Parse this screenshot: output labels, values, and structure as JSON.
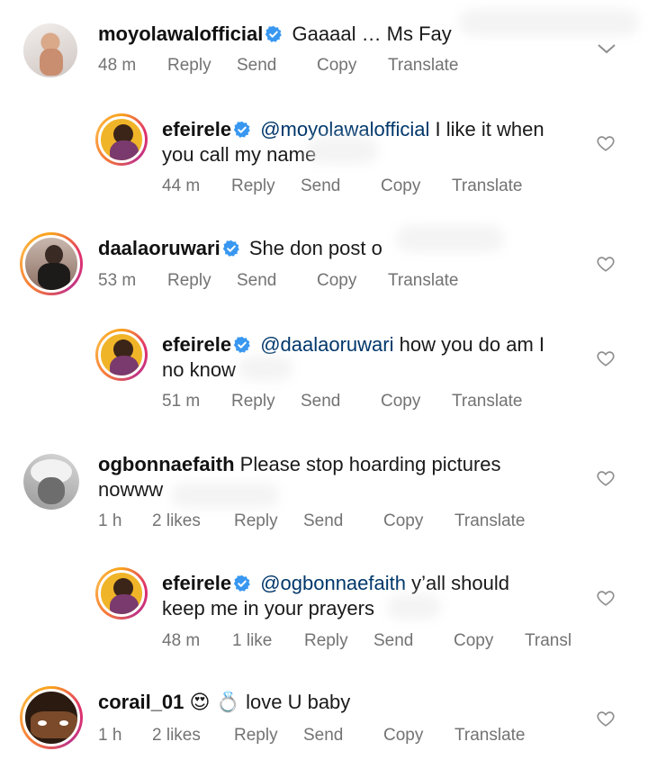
{
  "comments": [
    {
      "username": "moyolawalofficial",
      "verified": true,
      "mention": "",
      "text": "Gaaaal … Ms Fay",
      "time": "48 m",
      "likes": "",
      "actions": {
        "reply": "Reply",
        "send": "Send",
        "copy": "Copy",
        "translate": "Translate"
      }
    },
    {
      "username": "efeirele",
      "verified": true,
      "mention": "@moyolawalofficial",
      "text_line1": "I like it when",
      "text_line2": "you call my name",
      "time": "44 m",
      "actions": {
        "reply": "Reply",
        "send": "Send",
        "copy": "Copy",
        "translate": "Translate"
      }
    },
    {
      "username": "daalaoruwari",
      "verified": true,
      "text": "She don post o",
      "time": "53 m",
      "actions": {
        "reply": "Reply",
        "send": "Send",
        "copy": "Copy",
        "translate": "Translate"
      }
    },
    {
      "username": "efeirele",
      "verified": true,
      "mention": "@daalaoruwari",
      "text_line1": "how you do am I",
      "text_line2": "no know",
      "time": "51 m",
      "actions": {
        "reply": "Reply",
        "send": "Send",
        "copy": "Copy",
        "translate": "Translate"
      }
    },
    {
      "username": "ogbonnaefaith",
      "verified": false,
      "text_line1": "Please stop hoarding pictures",
      "text_line2": "nowww",
      "time": "1 h",
      "likes": "2 likes",
      "actions": {
        "reply": "Reply",
        "send": "Send",
        "copy": "Copy",
        "translate": "Translate"
      }
    },
    {
      "username": "efeirele",
      "verified": true,
      "mention": "@ogbonnaefaith",
      "text_line1": "y’all should",
      "text_line2": "keep me in your prayers",
      "time": "48 m",
      "likes": "1 like",
      "actions": {
        "reply": "Reply",
        "send": "Send",
        "copy": "Copy",
        "translate": "Transl"
      }
    },
    {
      "username": "corail_01",
      "verified": false,
      "emoji": "😍 💍",
      "text": "love U baby",
      "time": "1 h",
      "likes": "2 likes",
      "actions": {
        "reply": "Reply",
        "send": "Send",
        "copy": "Copy",
        "translate": "Translate"
      }
    }
  ],
  "colors": {
    "verified": "#3897f0",
    "mention": "#00376b",
    "meta": "#737373",
    "story_ring": [
      "#f9a11b",
      "#e1306c",
      "#c13584"
    ]
  },
  "icons": [
    "verified-badge-icon",
    "heart-icon",
    "chevron-down-icon"
  ]
}
